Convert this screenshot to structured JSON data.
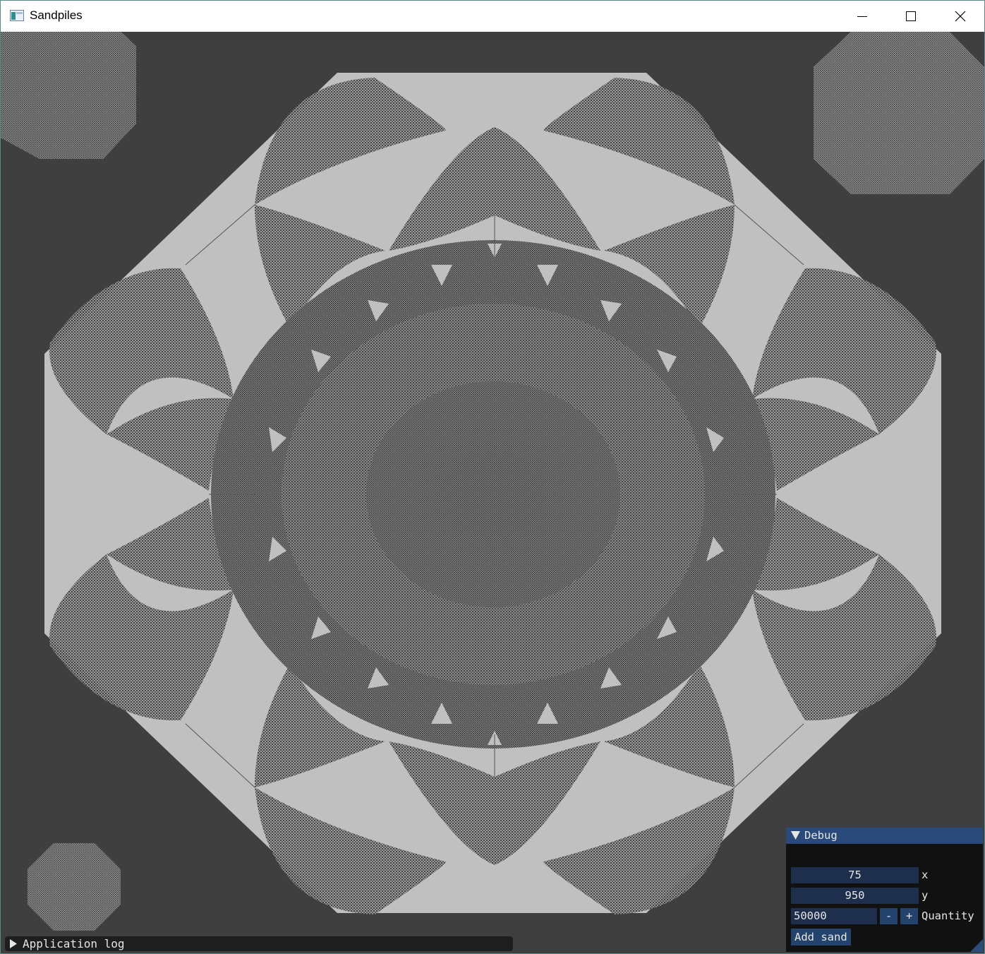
{
  "window": {
    "title": "Sandpiles",
    "icons": [
      "app-icon",
      "minimize-icon",
      "maximize-icon",
      "close-icon"
    ]
  },
  "colors": {
    "background": "#3f3f3f",
    "sand_light": "#c0c0c0",
    "sand_dark": "#3a3a3a",
    "panel_title": "#294a7a",
    "field_bg": "#1d2f4c"
  },
  "debug_panel": {
    "title": "Debug",
    "x_value": "75",
    "x_label": "x",
    "y_value": "950",
    "y_label": "y",
    "quantity_value": "50000",
    "minus_label": "-",
    "plus_label": "+",
    "quantity_label": "Quantity",
    "add_button": "Add sand"
  },
  "app_log": {
    "label": "Application log"
  }
}
